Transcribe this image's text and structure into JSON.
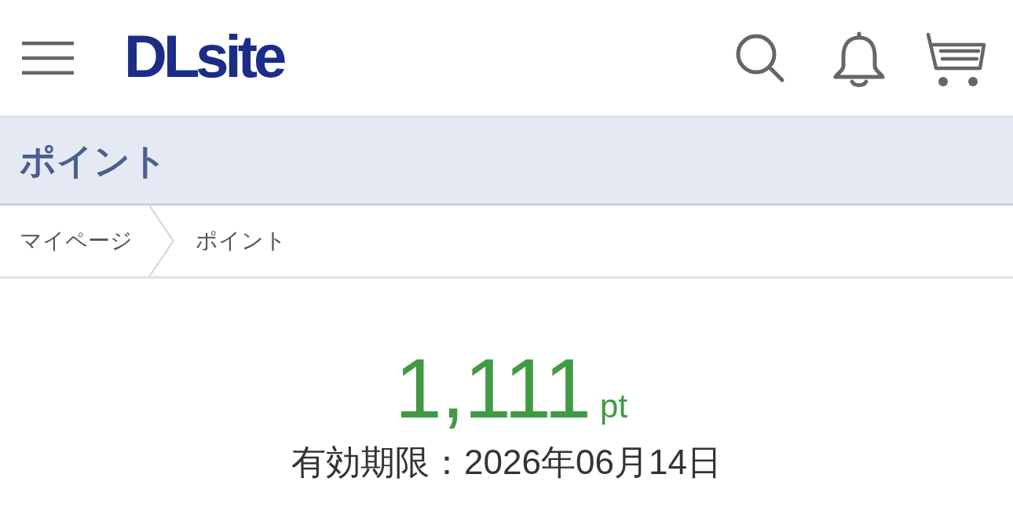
{
  "header": {
    "logo": "DLsite"
  },
  "page_title": "ポイント",
  "breadcrumbs": [
    {
      "label": "マイページ"
    },
    {
      "label": "ポイント"
    }
  ],
  "points": {
    "value": "1,111",
    "unit": "pt",
    "expiry": "有効期限：2026年06月14日"
  }
}
